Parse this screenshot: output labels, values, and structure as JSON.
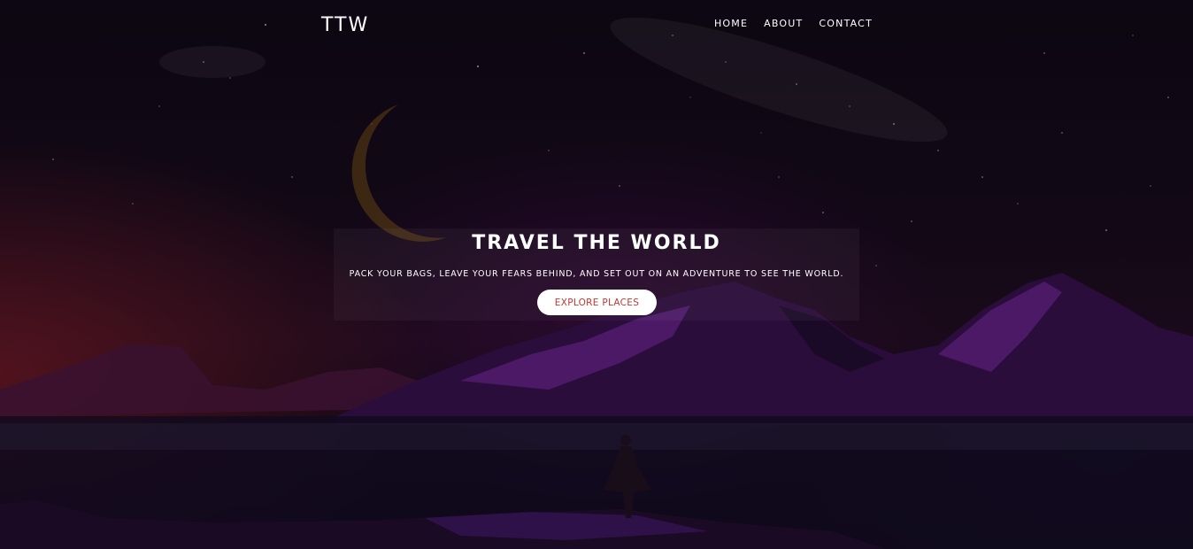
{
  "navbar": {
    "logo": "TTW",
    "links": [
      {
        "label": "HOME"
      },
      {
        "label": "ABOUT"
      },
      {
        "label": "CONTACT"
      }
    ]
  },
  "hero": {
    "title": "TRAVEL THE WORLD",
    "subtitle": "PACK YOUR BAGS, LEAVE YOUR FEARS BEHIND, AND SET OUT ON AN ADVENTURE TO SEE THE WORLD.",
    "cta_label": "EXPLORE PLACES"
  },
  "colors": {
    "cta_text": "#c7362f",
    "cta_background": "#ffffff",
    "text": "#ffffff",
    "background": "#0b0612"
  }
}
